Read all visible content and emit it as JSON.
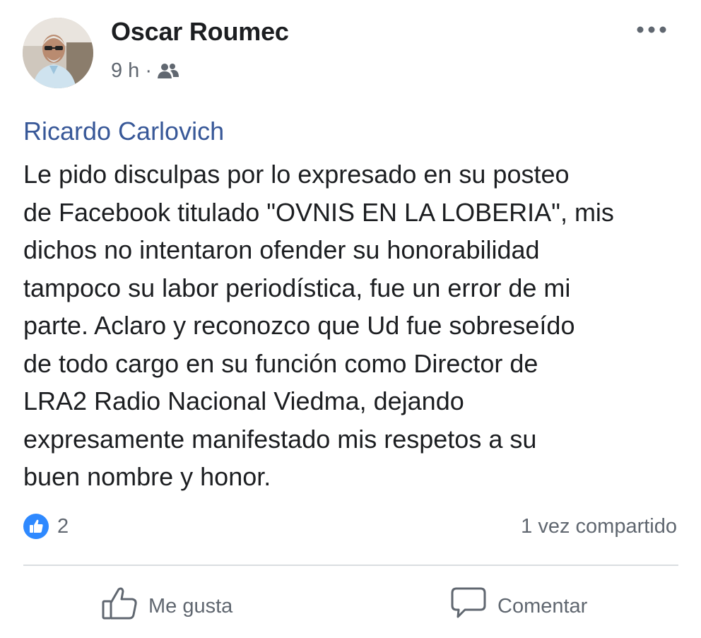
{
  "post": {
    "author": "Oscar Roumec",
    "time": "9 h",
    "separator": "·",
    "audience_icon": "friends-icon",
    "more_icon": "more-options-icon",
    "mention": "Ricardo Carlovich",
    "text": "Le pido disculpas por lo expresado en su posteo\nde Facebook titulado \"OVNIS EN LA LOBERIA\", mis\ndichos no intentaron ofender su honorabilidad\ntampoco su labor periodística, fue un error de mi\nparte. Aclaro y reconozco que Ud fue sobreseído\nde todo cargo en su función como Director de\nLRA2 Radio Nacional Viedma, dejando\nexpresamente manifestado mis respetos a su\nbuen nombre y honor."
  },
  "reactions": {
    "icon": "like-reaction-icon",
    "count": "2",
    "shares": "1 vez compartido"
  },
  "actions": {
    "like_label": "Me gusta",
    "comment_label": "Comentar"
  },
  "colors": {
    "link": "#385898",
    "like_blue": "#2e89ff",
    "muted": "#606770",
    "text": "#1c1e21"
  }
}
